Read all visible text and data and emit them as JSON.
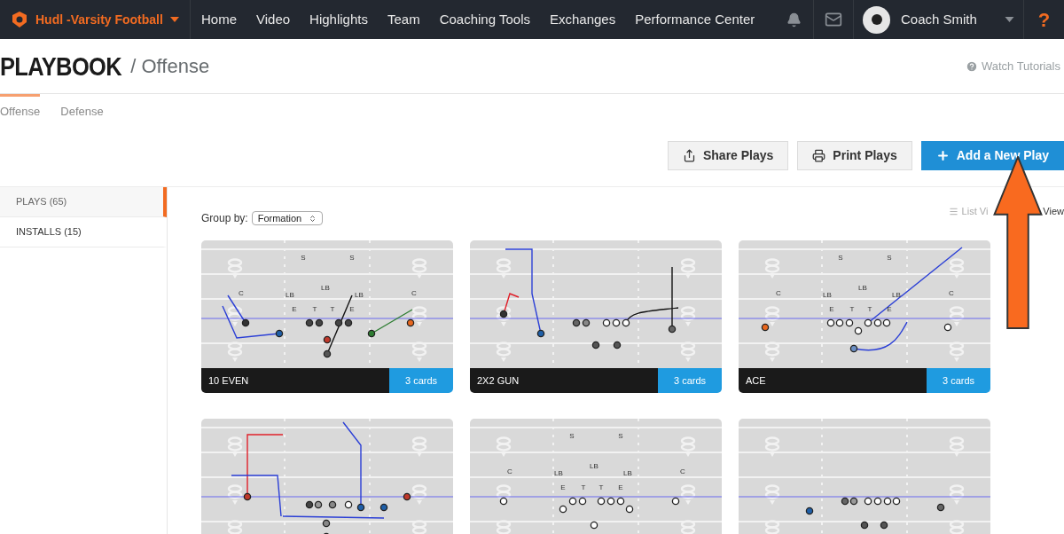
{
  "nav": {
    "brand": "Hudl -Varsity Football",
    "items": [
      "Home",
      "Video",
      "Highlights",
      "Team",
      "Coaching Tools",
      "Exchanges",
      "Performance Center"
    ],
    "user": "Coach Smith",
    "help": "?"
  },
  "header": {
    "title": "PLAYBOOK",
    "subtitle": "/ Offense",
    "tutorials": "Watch Tutorials"
  },
  "tabs": [
    {
      "label": "Offense",
      "selected": true
    },
    {
      "label": "Defense",
      "selected": false
    }
  ],
  "actions": [
    {
      "label": "Share Plays",
      "kind": "share"
    },
    {
      "label": "Print Plays",
      "kind": "print"
    },
    {
      "label": "Add a New Play",
      "kind": "add"
    }
  ],
  "sidebar": {
    "items": [
      {
        "label": "PLAYS (65)",
        "selected": true
      },
      {
        "label": "INSTALLS (15)",
        "selected": false
      }
    ]
  },
  "group_by": {
    "label": "Group by:",
    "value": "Formation"
  },
  "view_toggle": {
    "list": "List Vi",
    "grid": "View"
  },
  "plays": [
    {
      "name": "10 EVEN",
      "cards": "3 cards",
      "defense": [
        "S",
        "S",
        "C",
        "LB",
        "LB",
        "LB",
        "C",
        "E",
        "T",
        "T",
        "E"
      ]
    },
    {
      "name": "2X2 GUN",
      "cards": "3 cards"
    },
    {
      "name": "ACE",
      "cards": "3 cards",
      "defense": [
        "S",
        "S",
        "C",
        "LB",
        "LB",
        "LB",
        "C",
        "E",
        "T",
        "T",
        "E"
      ]
    },
    {
      "kind": "play"
    },
    {
      "defense": [
        "S",
        "S",
        "C",
        "LB",
        "LB",
        "LB",
        "C",
        "E",
        "T",
        "T",
        "E"
      ]
    },
    {
      "kind": "play"
    }
  ]
}
